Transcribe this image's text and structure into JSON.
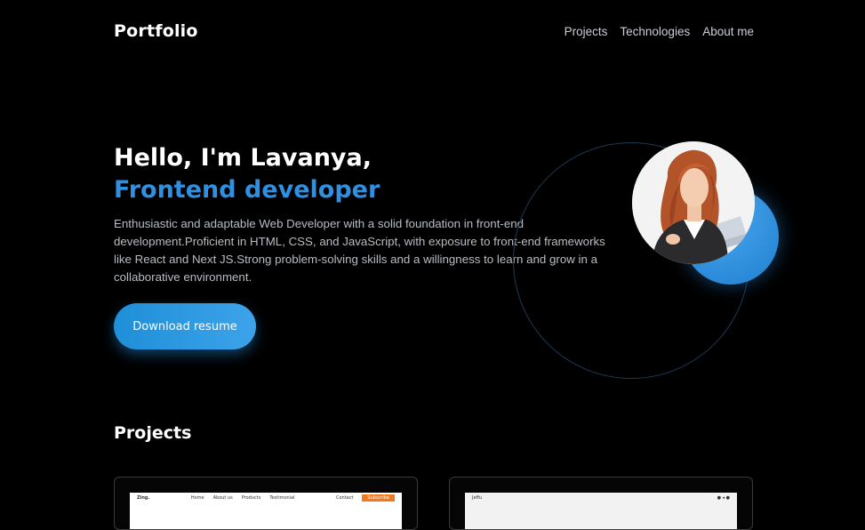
{
  "nav": {
    "brand": "Portfolio",
    "links": [
      "Projects",
      "Technologies",
      "About me"
    ]
  },
  "hero": {
    "greeting": "Hello, I'm Lavanya,",
    "role": "Frontend developer",
    "intro": "Enthusiastic and adaptable Web Developer with a solid foundation in front-end development.Proficient in HTML, CSS, and JavaScript, with exposure to front-end frameworks like React and Next JS.Strong problem-solving skills and a willingness to learn and grow in a collaborative environment.",
    "button_label": "Download resume"
  },
  "projects": {
    "title": "Projects",
    "card1": {
      "logo": "Zing.",
      "menu": [
        "Home",
        "About us",
        "Products",
        "Testimonial"
      ],
      "right": "Contact",
      "cta": "Subscribe"
    },
    "card2": {
      "logo": "Jeffu"
    }
  },
  "colors": {
    "background": "#000000",
    "accent": "#2f8fe0",
    "button": "#2d9ae4"
  }
}
